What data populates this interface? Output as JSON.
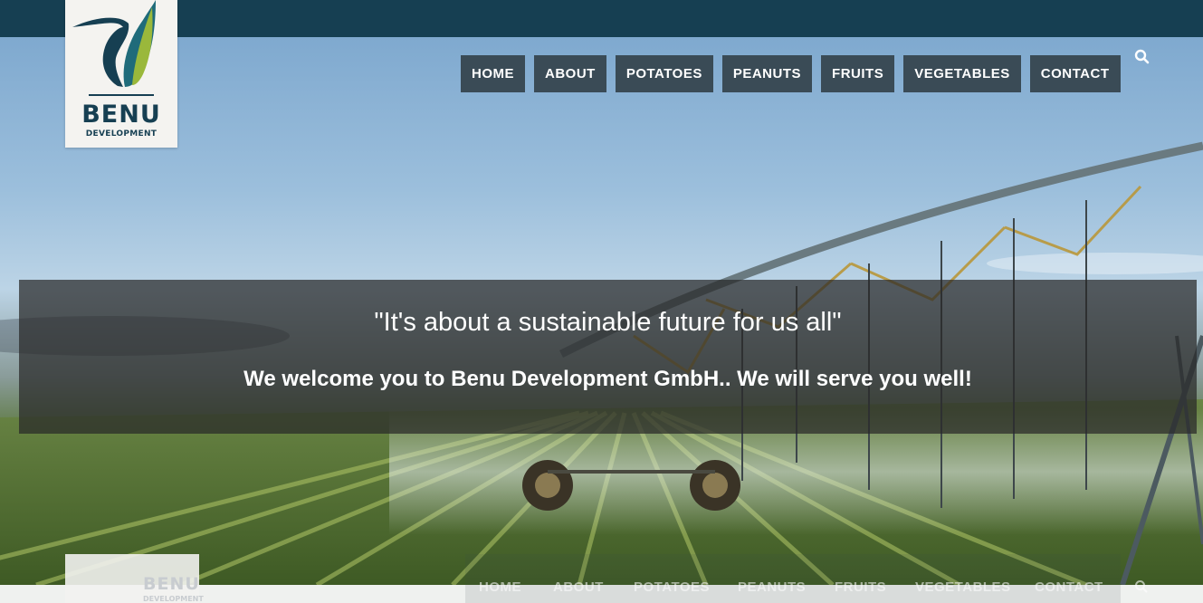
{
  "brand": {
    "name": "BENU",
    "tagline": "DEVELOPMENT",
    "colors": {
      "navy": "#163f52",
      "teal": "#1f6b7a",
      "lime": "#9ab83b"
    }
  },
  "nav": {
    "items": [
      "HOME",
      "ABOUT",
      "POTATOES",
      "PEANUTS",
      "FRUITS",
      "VEGETABLES",
      "CONTACT"
    ],
    "search_icon": "search-icon",
    "button_color": "#3a4b56"
  },
  "hero": {
    "quote": "\"It's about a sustainable future for us all\"",
    "welcome": "We welcome you to Benu Development GmbH.. We will serve you well!"
  },
  "sticky_header": {
    "brand": "BENU",
    "tagline": "DEVELOPMENT",
    "items": [
      "HOME",
      "ABOUT",
      "POTATOES",
      "PEANUTS",
      "FRUITS",
      "VEGETABLES",
      "CONTACT"
    ]
  }
}
